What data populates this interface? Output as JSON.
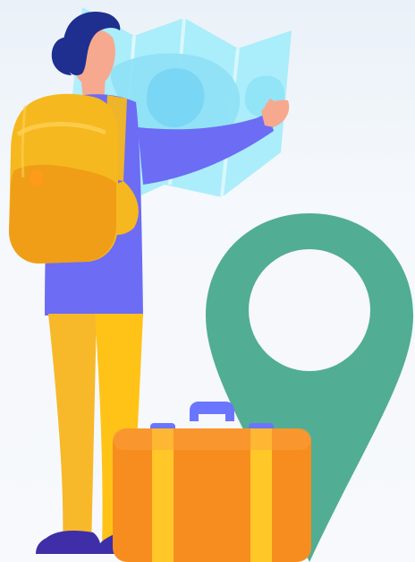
{
  "scene": {
    "subject": "traveler-with-map-and-suitcase",
    "icons": [
      "map-icon",
      "location-pin-icon",
      "suitcase-icon",
      "backpack-icon"
    ]
  },
  "colors": {
    "background": "#f3f7fb",
    "map_light": "#a6ecfb",
    "map_mid": "#8fe2f6",
    "map_spot": "#79d6f5",
    "hair": "#1e2f8f",
    "skin": "#f6a98f",
    "shirt": "#6c6cf5",
    "backpack": "#f6b81f",
    "backpack_shadow": "#ef9b16",
    "pants": "#f7b82a",
    "shoes": "#3e2ea8",
    "pin": "#51ad93",
    "pin_hole": "#f6f8fb",
    "suitcase": "#f88d1f",
    "suitcase_stripe": "#ffc828",
    "suitcase_handle": "#6a76ff"
  }
}
